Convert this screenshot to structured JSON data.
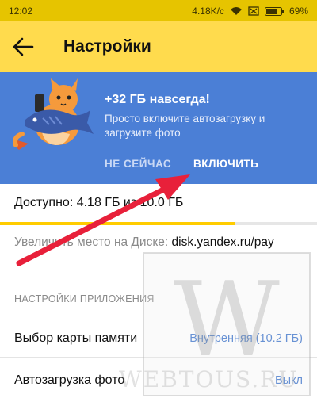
{
  "status_bar": {
    "time": "12:02",
    "network_speed": "4.18K/c",
    "battery": "69%"
  },
  "app_bar": {
    "title": "Настройки"
  },
  "promo": {
    "title": "+32 ГБ навсегда!",
    "description": "Просто включите автозагрузку и загрузите фото",
    "later_button": "НЕ СЕЙЧАС",
    "enable_button": "ВКЛЮЧИТЬ",
    "background_color": "#4b7fd6"
  },
  "storage": {
    "available_text": "Доступно: 4.18 ГБ из 10.0 ГБ",
    "used_fraction": 0.74
  },
  "increase_space": {
    "label": "Увеличить место на Диске: ",
    "link": "disk.yandex.ru/pay"
  },
  "app_settings": {
    "header": "НАСТРОЙКИ ПРИЛОЖЕНИЯ",
    "rows": [
      {
        "label": "Выбор карты памяти",
        "value": "Внутренняя (10.2 ГБ)"
      },
      {
        "label": "Автозагрузка фото",
        "value": "Выкл"
      }
    ]
  },
  "watermark": {
    "letter": "W",
    "caption": "WEBTOUS.RU"
  },
  "colors": {
    "status_bar": "#e6c400",
    "app_bar": "#ffdb4d",
    "accent_blue": "#3d74cc",
    "arrow": "#e8203a"
  }
}
